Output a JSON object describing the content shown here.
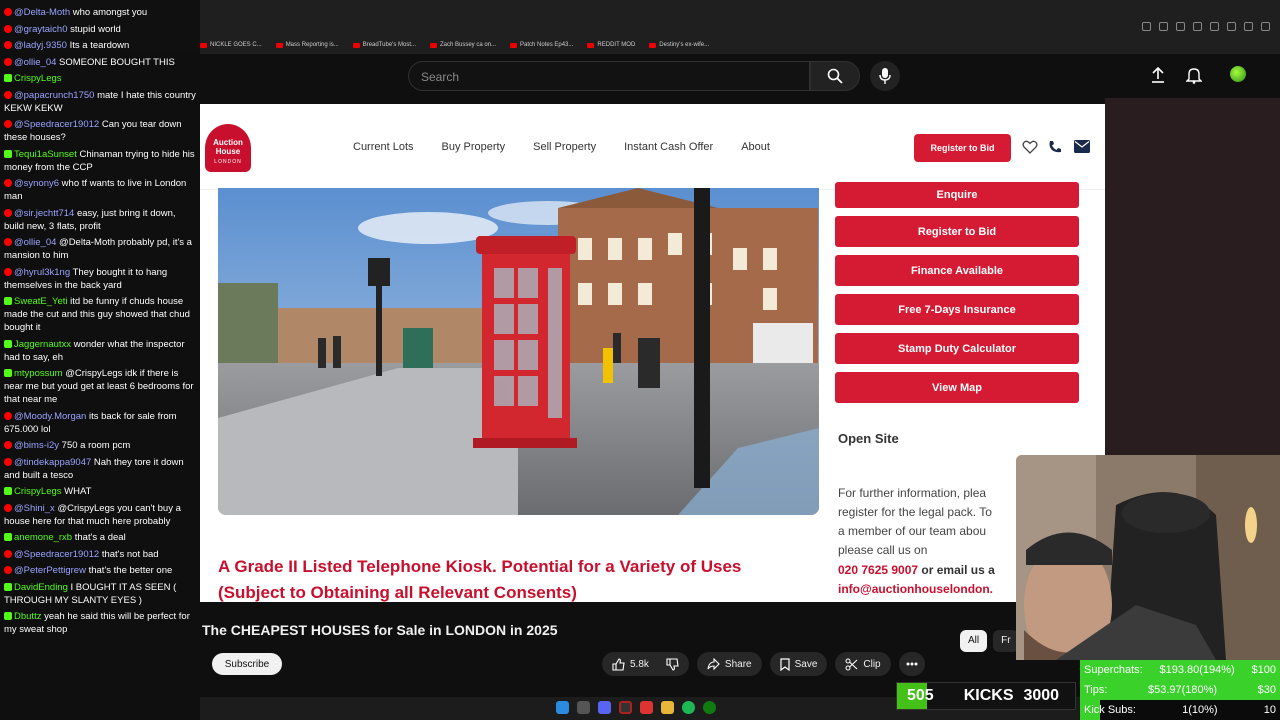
{
  "browser": {
    "bookmarks": [
      "NICKLE GOES C...",
      "Mass Reporting is...",
      "BreadTube's Most...",
      "Zach Bussey ca on...",
      "Patch Notes Ep43...",
      "REDDIT MOD",
      "Destiny's ex-wife..."
    ]
  },
  "youtube": {
    "search_placeholder": "Search",
    "video_title": "The CHEAPEST HOUSES for Sale in LONDON in 2025",
    "subscribe_label": "Subscribe",
    "likes": "5.8k",
    "share_label": "Share",
    "save_label": "Save",
    "clip_label": "Clip",
    "chips": [
      "All",
      "Fr"
    ]
  },
  "site": {
    "logo_text": "Auction House",
    "logo_sub": "LONDON",
    "nav": [
      "Current Lots",
      "Buy Property",
      "Sell Property",
      "Instant Cash Offer",
      "About"
    ],
    "register_btn": "Register to Bid",
    "side_buttons": [
      "Enquire",
      "Register to Bid",
      "Finance Available",
      "Free 7-Days Insurance",
      "Stamp Duty Calculator",
      "View Map"
    ],
    "open_site": "Open Site",
    "further_info": [
      "For further information, plea",
      "register for the legal pack. To",
      "a member of our team abou",
      "please call us on"
    ],
    "phone": "020 7625 9007",
    "phone_suffix": " or email us a",
    "email": "info@auctionhouselondon.",
    "listing_title_1": "A Grade II Listed Telephone Kiosk. Potential for a Variety of Uses",
    "listing_title_2": "(Subject to Obtaining all Relevant Consents)",
    "brand_color": "#d51b34"
  },
  "chat": [
    {
      "platform": "yt",
      "user": "@Delta-Moth",
      "text": "who amongst you"
    },
    {
      "platform": "yt",
      "user": "@graytaich0",
      "text": "stupid world"
    },
    {
      "platform": "yt",
      "user": "@ladyj.9350",
      "text": "Its a teardown"
    },
    {
      "platform": "yt",
      "user": "@ollie_04",
      "text": "SOMEONE BOUGHT THIS"
    },
    {
      "platform": "kick",
      "user": "CrispyLegs",
      "text": ""
    },
    {
      "platform": "yt",
      "user": "@papacrunch1750",
      "text": "mate I hate this country KEKW KEKW"
    },
    {
      "platform": "yt",
      "user": "@Speedracer19012",
      "text": "Can you tear down these houses?"
    },
    {
      "platform": "kick",
      "user": "Tequi1aSunset",
      "text": "Chinaman trying to hide his money from the CCP"
    },
    {
      "platform": "yt",
      "user": "@synony6",
      "text": "who tf wants to live in London man"
    },
    {
      "platform": "yt",
      "user": "@sir.jechtt714",
      "text": "easy, just bring it down, build new, 3 flats, profit"
    },
    {
      "platform": "yt",
      "user": "@ollie_04",
      "text": "@Delta-Moth probably pd, it's a mansion to him"
    },
    {
      "platform": "yt",
      "user": "@hyrul3k1ng",
      "text": "They bought it to hang themselves in the back yard"
    },
    {
      "platform": "kick",
      "user": "SweatE_Yeti",
      "text": "itd be funny if chuds house made the cut and this guy showed that chud bought it"
    },
    {
      "platform": "kick",
      "user": "Jaggernautxx",
      "text": "wonder what the inspector had to say, eh"
    },
    {
      "platform": "kick",
      "user": "mtypossum",
      "text": "@CrispyLegs idk if there is near me but youd get at least 6 bedrooms for that near me"
    },
    {
      "platform": "yt",
      "user": "@Moody.Morgan",
      "text": "its back for sale from 675.000 lol"
    },
    {
      "platform": "yt",
      "user": "@bims-i2y",
      "text": "750 a room pcm"
    },
    {
      "platform": "yt",
      "user": "@tindekappa9047",
      "text": "Nah they tore it down and built a tesco"
    },
    {
      "platform": "kick",
      "user": "CrispyLegs",
      "text": "WHAT"
    },
    {
      "platform": "yt",
      "user": "@Shini_x",
      "text": "@CrispyLegs you can't buy a house here for that much here probably"
    },
    {
      "platform": "kick",
      "user": "anemone_rxb",
      "text": "that's a deal"
    },
    {
      "platform": "yt",
      "user": "@Speedracer19012",
      "text": "that's not bad"
    },
    {
      "platform": "yt",
      "user": "@PeterPettigrew",
      "text": "that's the better one"
    },
    {
      "platform": "kick",
      "user": "DavidEnding",
      "text": "I BOUGHT IT AS SEEN ( THROUGH MY SLANTY EYES )"
    },
    {
      "platform": "kick",
      "user": "Dbuttz",
      "text": "yeah he said this will be perfect for my sweat shop"
    }
  ],
  "overlay": {
    "kicks_count": "505",
    "kicks_label": "KICKS",
    "kicks_goal": "3000",
    "kicks_progress": 0.168,
    "stats": [
      {
        "label": "Superchats:",
        "value": "$193.80(194%)",
        "goal": "$100",
        "progress": 1.0
      },
      {
        "label": "Tips:",
        "value": "$53.97(180%)",
        "goal": "$30",
        "progress": 1.0
      },
      {
        "label": "Kick Subs:",
        "value": "1(10%)",
        "goal": "10",
        "progress": 0.1
      }
    ]
  }
}
